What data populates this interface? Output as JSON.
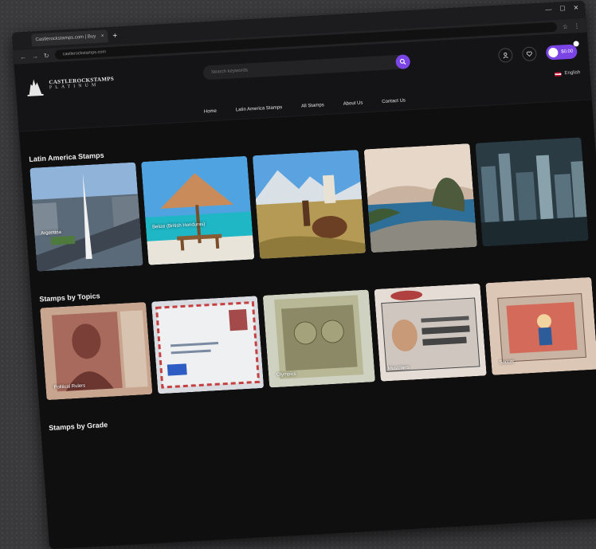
{
  "browser": {
    "tab_title": "Castlerockstamps.com | Buy",
    "new_tab": "+",
    "url": "castlerockstamps.com"
  },
  "header": {
    "logo_line1": "CASTLEROCKSTAMPS",
    "logo_line2": "PLATINUM",
    "search_placeholder": "Search keywords",
    "cart_amount": "$0.00",
    "language": "English"
  },
  "nav": {
    "items": [
      "Home",
      "Latin America Stamps",
      "All Stamps",
      "About Us",
      "Contact Us"
    ]
  },
  "sections": {
    "latin_title": "Latin America Stamps",
    "latin_cards": [
      {
        "label": "Argentina",
        "icon": "obelisk-photo"
      },
      {
        "label": "Belize (British Honduras)",
        "icon": "beach-hut-photo"
      },
      {
        "label": "",
        "icon": "llama-photo"
      },
      {
        "label": "",
        "icon": "rio-photo"
      },
      {
        "label": "",
        "icon": "city-photo"
      }
    ],
    "topics_title": "Stamps by Topics",
    "topic_cards": [
      {
        "label": "Political Rulers",
        "icon": "portrait-stamp"
      },
      {
        "label": "",
        "icon": "airmail-envelope"
      },
      {
        "label": "Olympics",
        "icon": "map-stamp"
      },
      {
        "label": "Musicians",
        "icon": "musician-stamp"
      },
      {
        "label": "Soccer",
        "icon": "soccer-stamp"
      }
    ],
    "grade_title": "Stamps by Grade"
  }
}
